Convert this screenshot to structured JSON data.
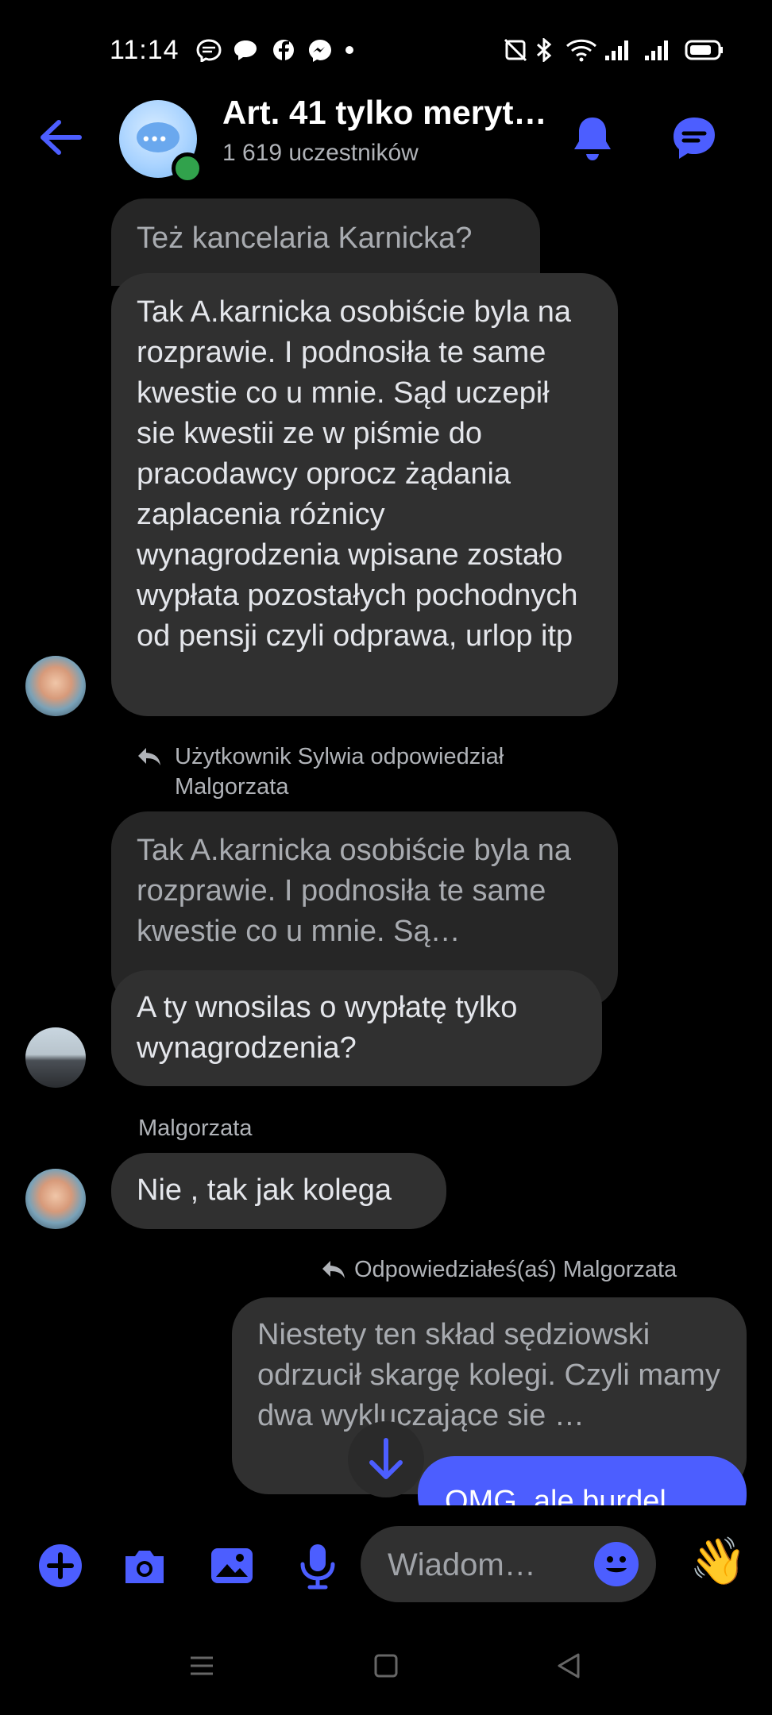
{
  "status_bar": {
    "time": "11:14"
  },
  "header": {
    "title": "Art. 41 tylko meryt…",
    "subtitle": "1 619 uczestników"
  },
  "messages": {
    "m1_quote": "Też kancelaria Karnicka?",
    "m2_text": "Tak A.karnicka osobiście byla na rozprawie.  I podnosiła te same kwestie co u mnie. Sąd uczepił sie kwestii ze w piśmie do pracodawcy oprocz żądania zaplacenia różnicy wynagrodzenia wpisane zostało wypłata pozostałych pochodnych od pensji czyli odprawa, urlop itp",
    "m3_reply_label": "Użytkownik Sylwia odpowiedział Malgorzata",
    "m3_quote": "Tak A.karnicka osobiście byla na rozprawie.  I podnosiła te same kwestie co u mnie. Są…",
    "m3_text": "A ty wnosilas o wypłatę tylko wynagrodzenia?",
    "m4_sender": "Malgorzata",
    "m4_text": "Nie , tak jak kolega",
    "m5_reply_label": "Odpowiedziałeś(aś) Malgorzata",
    "m5_quote": "Niestety ten skład sędziowski odrzucił skargę kolegi. Czyli mamy dwa wykluczające sie …",
    "m5_text": "OMG, ale burdel …"
  },
  "composer": {
    "placeholder": "Wiadom…",
    "wave_emoji": "👋"
  },
  "colors": {
    "accent": "#4c5eff",
    "bubble_incoming": "#303030",
    "background": "#000000",
    "online": "#31a24c"
  },
  "icons": [
    "back-arrow-icon",
    "bell-icon",
    "chat-icon",
    "plus-icon",
    "camera-icon",
    "gallery-icon",
    "microphone-icon",
    "emoji-icon",
    "wave-icon",
    "arrow-down-icon"
  ]
}
